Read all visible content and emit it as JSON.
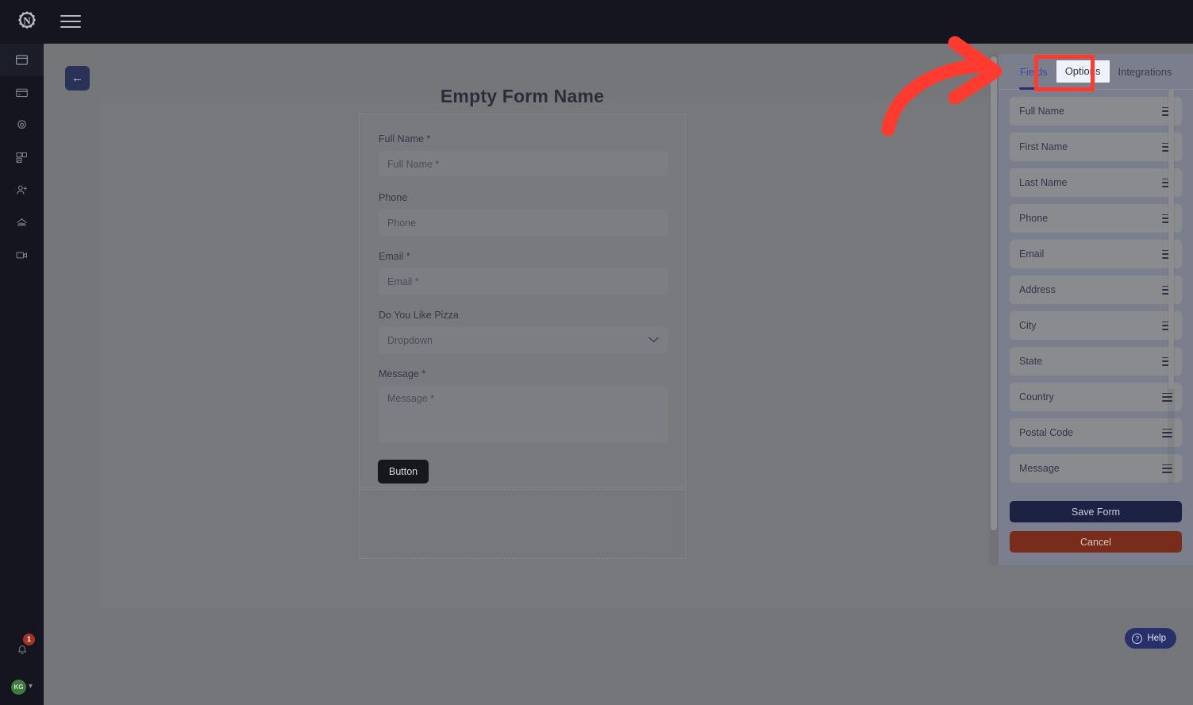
{
  "app": {
    "brand_icon": "gear-n-logo",
    "menu_icon": "hamburger-menu-icon"
  },
  "sidebar": {
    "items": [
      {
        "icon": "browser-window-icon",
        "active": true
      },
      {
        "icon": "credit-card-icon",
        "active": false
      },
      {
        "icon": "gear-icon",
        "active": false
      },
      {
        "icon": "image-template-icon",
        "active": false
      },
      {
        "icon": "add-user-icon",
        "active": false
      },
      {
        "icon": "network-home-icon",
        "active": false
      },
      {
        "icon": "video-camera-icon",
        "active": false
      }
    ],
    "notification": {
      "icon": "bell-icon",
      "count": "1"
    },
    "user": {
      "initials": "KG",
      "chevron": "▾"
    }
  },
  "builder": {
    "back_button_icon": "←",
    "form_title": "Empty Form Name",
    "fields": [
      {
        "label": "Full Name *",
        "placeholder": "Full Name *",
        "type": "text"
      },
      {
        "label": "Phone",
        "placeholder": "Phone",
        "type": "text"
      },
      {
        "label": "Email *",
        "placeholder": "Email *",
        "type": "text"
      },
      {
        "label": "Do You Like Pizza",
        "placeholder": "Dropdown",
        "type": "select"
      },
      {
        "label": "Message *",
        "placeholder": "Message *",
        "type": "textarea"
      }
    ],
    "submit_label": "Button"
  },
  "panel": {
    "tabs": [
      {
        "label": "Fields",
        "active": true,
        "spotlight": false
      },
      {
        "label": "Options",
        "active": false,
        "spotlight": true
      },
      {
        "label": "Integrations",
        "active": false,
        "spotlight": false
      }
    ],
    "available_fields": [
      "Full Name",
      "First Name",
      "Last Name",
      "Phone",
      "Email",
      "Address",
      "City",
      "State",
      "Country",
      "Postal Code",
      "Message"
    ],
    "drag_handle_icon": "drag-handle-icon",
    "save_label": "Save Form",
    "cancel_label": "Cancel"
  },
  "help": {
    "label": "Help",
    "icon": "question-mark-icon"
  },
  "annotation": {
    "arrow_color": "#ff3b2f",
    "highlight_target": "Options"
  },
  "colors": {
    "chrome_dark": "#14151f",
    "overlay_grey": "#75767a",
    "accent_blue": "#3c4fa0",
    "save_navy": "#1d2244",
    "cancel_red": "#7a2c1c",
    "badge_red": "#a93226",
    "avatar_green": "#3f7a3f"
  }
}
